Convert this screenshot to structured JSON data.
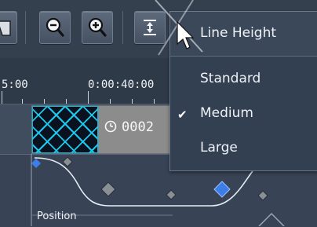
{
  "toolbar": {
    "buttons": [
      {
        "icon": "clip-icon"
      },
      {
        "icon": "zoom-out-icon"
      },
      {
        "icon": "zoom-in-icon"
      },
      {
        "icon": "line-height-icon"
      }
    ]
  },
  "ruler": {
    "labels": [
      "5:00",
      "0:00:40:00"
    ]
  },
  "clip": {
    "time_text": "0002"
  },
  "lane": {
    "label": "Position"
  },
  "menu": {
    "title": "Line Height",
    "items": [
      {
        "label": "Standard",
        "checked": false
      },
      {
        "label": "Medium",
        "checked": true
      },
      {
        "label": "Large",
        "checked": false
      }
    ],
    "check_glyph": "✔"
  },
  "colors": {
    "selected_keyframe": "#3d7ee6",
    "keyframe": "#8a8f96",
    "clip_pattern": "#19c9f0"
  }
}
